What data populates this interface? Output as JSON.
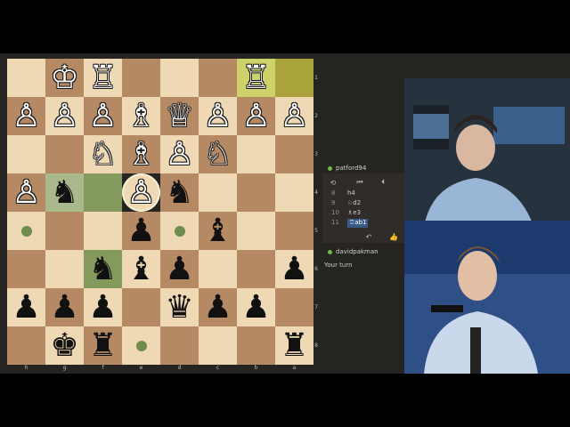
{
  "board": {
    "rows": [
      [
        {
          "p": "",
          "c": "light"
        },
        {
          "p": "wK",
          "c": "dark"
        },
        {
          "p": "wR",
          "c": "light"
        },
        {
          "p": "",
          "c": "dark"
        },
        {
          "p": "",
          "c": "light"
        },
        {
          "p": "",
          "c": "dark"
        },
        {
          "p": "wR",
          "c": "hl-light"
        },
        {
          "p": "",
          "c": "hl-dark"
        }
      ],
      [
        {
          "p": "wP",
          "c": "dark"
        },
        {
          "p": "wP",
          "c": "light"
        },
        {
          "p": "wP",
          "c": "dark"
        },
        {
          "p": "wB",
          "c": "light"
        },
        {
          "p": "wQ",
          "c": "dark"
        },
        {
          "p": "wP",
          "c": "light"
        },
        {
          "p": "wP",
          "c": "dark"
        },
        {
          "p": "wP",
          "c": "light"
        }
      ],
      [
        {
          "p": "",
          "c": "light"
        },
        {
          "p": "",
          "c": "dark"
        },
        {
          "p": "wN",
          "c": "light"
        },
        {
          "p": "wB",
          "c": "dark"
        },
        {
          "p": "wP",
          "c": "light"
        },
        {
          "p": "wN",
          "c": "dark"
        },
        {
          "p": "",
          "c": "light"
        },
        {
          "p": "",
          "c": "dark"
        }
      ],
      [
        {
          "p": "wP",
          "c": "dark"
        },
        {
          "p": "bN",
          "c": "sel-light"
        },
        {
          "p": "",
          "c": "sel-dark"
        },
        {
          "p": "wP",
          "c": "light",
          "sel": true
        },
        {
          "p": "bN",
          "c": "dark"
        },
        {
          "p": "",
          "c": "light"
        },
        {
          "p": "",
          "c": "dark"
        },
        {
          "p": "",
          "c": "light"
        }
      ],
      [
        {
          "p": "dot",
          "c": "light"
        },
        {
          "p": "",
          "c": "dark"
        },
        {
          "p": "",
          "c": "light"
        },
        {
          "p": "bP",
          "c": "dark"
        },
        {
          "p": "dot",
          "c": "light"
        },
        {
          "p": "bB",
          "c": "dark"
        },
        {
          "p": "",
          "c": "light"
        },
        {
          "p": "",
          "c": "dark"
        }
      ],
      [
        {
          "p": "",
          "c": "dark"
        },
        {
          "p": "",
          "c": "light"
        },
        {
          "p": "bN",
          "c": "sel-dark"
        },
        {
          "p": "bB",
          "c": "light"
        },
        {
          "p": "bP",
          "c": "dark"
        },
        {
          "p": "",
          "c": "light"
        },
        {
          "p": "",
          "c": "dark"
        },
        {
          "p": "bP",
          "c": "light"
        }
      ],
      [
        {
          "p": "bP",
          "c": "light"
        },
        {
          "p": "bP",
          "c": "dark"
        },
        {
          "p": "bP",
          "c": "light"
        },
        {
          "p": "",
          "c": "dark"
        },
        {
          "p": "bQ",
          "c": "light"
        },
        {
          "p": "bP",
          "c": "dark"
        },
        {
          "p": "bP",
          "c": "light"
        },
        {
          "p": "",
          "c": "dark"
        }
      ],
      [
        {
          "p": "",
          "c": "dark"
        },
        {
          "p": "bK",
          "c": "light"
        },
        {
          "p": "bR",
          "c": "dark"
        },
        {
          "p": "dot",
          "c": "light"
        },
        {
          "p": "",
          "c": "dark"
        },
        {
          "p": "",
          "c": "light"
        },
        {
          "p": "",
          "c": "dark"
        },
        {
          "p": "bR",
          "c": "light"
        }
      ]
    ],
    "rank_labels": [
      "1",
      "2",
      "3",
      "4",
      "5",
      "6",
      "7",
      "8"
    ],
    "file_labels": [
      "h",
      "g",
      "f",
      "e",
      "d",
      "c",
      "b",
      "a"
    ]
  },
  "panel": {
    "opponent": "patford94",
    "player": "davidpakman",
    "status": "Your turn",
    "moves": [
      {
        "n": "8",
        "m": "h4"
      },
      {
        "n": "9",
        "m": "♘d2"
      },
      {
        "n": "10",
        "m": "♗e3"
      },
      {
        "n": "11",
        "m": "♖ab1"
      }
    ],
    "toolbar": {
      "flip": "⟲",
      "first": "⏮",
      "prev": "⏴"
    }
  },
  "glyphs": {
    "wK": "♔",
    "wQ": "♕",
    "wR": "♖",
    "wB": "♗",
    "wN": "♘",
    "wP": "♙",
    "bK": "♚",
    "bQ": "♛",
    "bR": "♜",
    "bB": "♝",
    "bN": "♞",
    "bP": "♟"
  }
}
